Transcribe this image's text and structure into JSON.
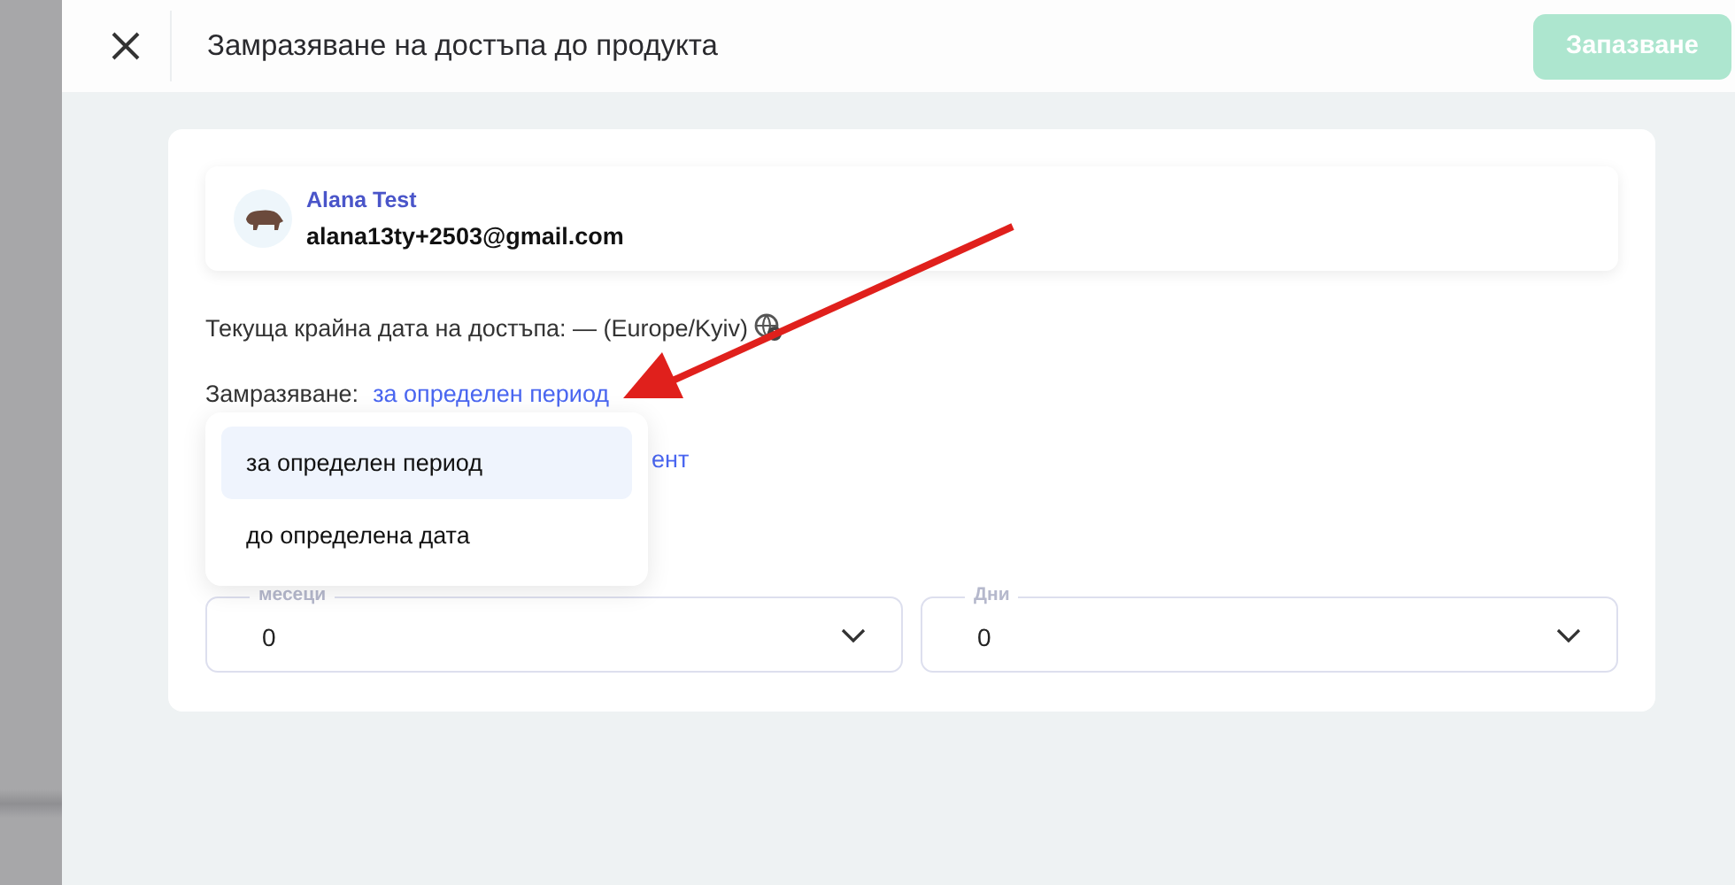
{
  "header": {
    "title": "Замразяване на достъпа до продукта",
    "save_button": {
      "label": "Запазване",
      "disabled": true
    }
  },
  "user": {
    "name": "Alana Test",
    "email": "alana13ty+2503@gmail.com"
  },
  "access_end": "Текуща крайна дата на достъпа: — (Europe/Kyiv)",
  "freeze": {
    "label": "Замразяване:",
    "value": "за определен период"
  },
  "covered_link": "ент",
  "dropdown": {
    "options": [
      {
        "label": "за определен период",
        "selected": true
      },
      {
        "label": "до определена дата",
        "selected": false
      }
    ]
  },
  "fields": [
    {
      "label": "месеци",
      "value": "0"
    },
    {
      "label": "Дни",
      "value": "0"
    }
  ]
}
